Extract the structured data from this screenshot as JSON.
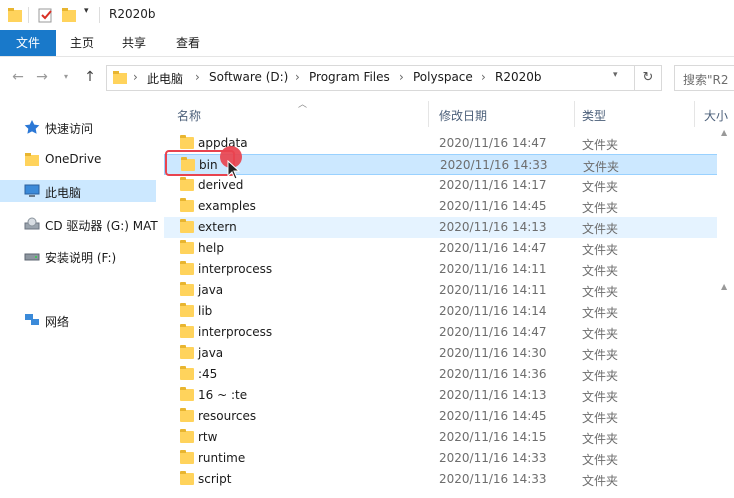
{
  "window": {
    "title": "R2020b"
  },
  "ribbon": {
    "tabs": [
      "文件",
      "主页",
      "共享",
      "查看"
    ]
  },
  "address": {
    "crumbs": [
      "此电脑",
      "Software (D:)",
      "Program Files",
      "Polyspace",
      "R2020b"
    ],
    "search_placeholder": "搜索\"R2"
  },
  "sidebar": {
    "items": [
      {
        "label": "快速访问",
        "icon": "star-icon"
      },
      {
        "label": "OneDrive",
        "icon": "folder-icon"
      },
      {
        "label": "此电脑",
        "icon": "computer-icon",
        "selected": true
      },
      {
        "label": "CD 驱动器 (G:) MAT",
        "icon": "cd-drive-icon"
      },
      {
        "label": "安装说明 (F:)",
        "icon": "drive-icon"
      },
      {
        "label": "网络",
        "icon": "network-icon"
      }
    ]
  },
  "columns": {
    "name": "名称",
    "date": "修改日期",
    "type": "类型",
    "size": "大小"
  },
  "files": [
    {
      "name": "appdata",
      "date": "2020/11/16 14:47",
      "type": "文件夹"
    },
    {
      "name": "bin",
      "date": "2020/11/16 14:33",
      "type": "文件夹",
      "selected": true
    },
    {
      "name": "derived",
      "date": "2020/11/16 14:17",
      "type": "文件夹"
    },
    {
      "name": "examples",
      "date": "2020/11/16 14:45",
      "type": "文件夹"
    },
    {
      "name": "extern",
      "date": "2020/11/16 14:13",
      "type": "文件夹",
      "hover": true
    },
    {
      "name": "help",
      "date": "2020/11/16 14:47",
      "type": "文件夹"
    },
    {
      "name": "interprocess",
      "date": "2020/11/16 14:11",
      "type": "文件夹"
    },
    {
      "name": "java",
      "date": "2020/11/16 14:11",
      "type": "文件夹"
    },
    {
      "name": "lib",
      "date": "2020/11/16 14:14",
      "type": "文件夹"
    },
    {
      "name": "interprocess",
      "date": "2020/11/16 14:47",
      "type": "文件夹"
    },
    {
      "name": "java",
      "date": "2020/11/16 14:30",
      "type": "文件夹"
    },
    {
      "name": ":45",
      "date": "2020/11/16 14:36",
      "type": "文件夹"
    },
    {
      "name": "16 ~ :te",
      "date": "2020/11/16 14:13",
      "type": "文件夹"
    },
    {
      "name": "resources",
      "date": "2020/11/16 14:45",
      "type": "文件夹"
    },
    {
      "name": "rtw",
      "date": "2020/11/16 14:15",
      "type": "文件夹"
    },
    {
      "name": "runtime",
      "date": "2020/11/16 14:33",
      "type": "文件夹"
    },
    {
      "name": "script",
      "date": "2020/11/16 14:33",
      "type": "文件夹"
    }
  ],
  "colors": {
    "accent": "#1979ca",
    "selection": "#cce8ff",
    "highlight": "#e8434f",
    "folder": "#ffd35c"
  }
}
